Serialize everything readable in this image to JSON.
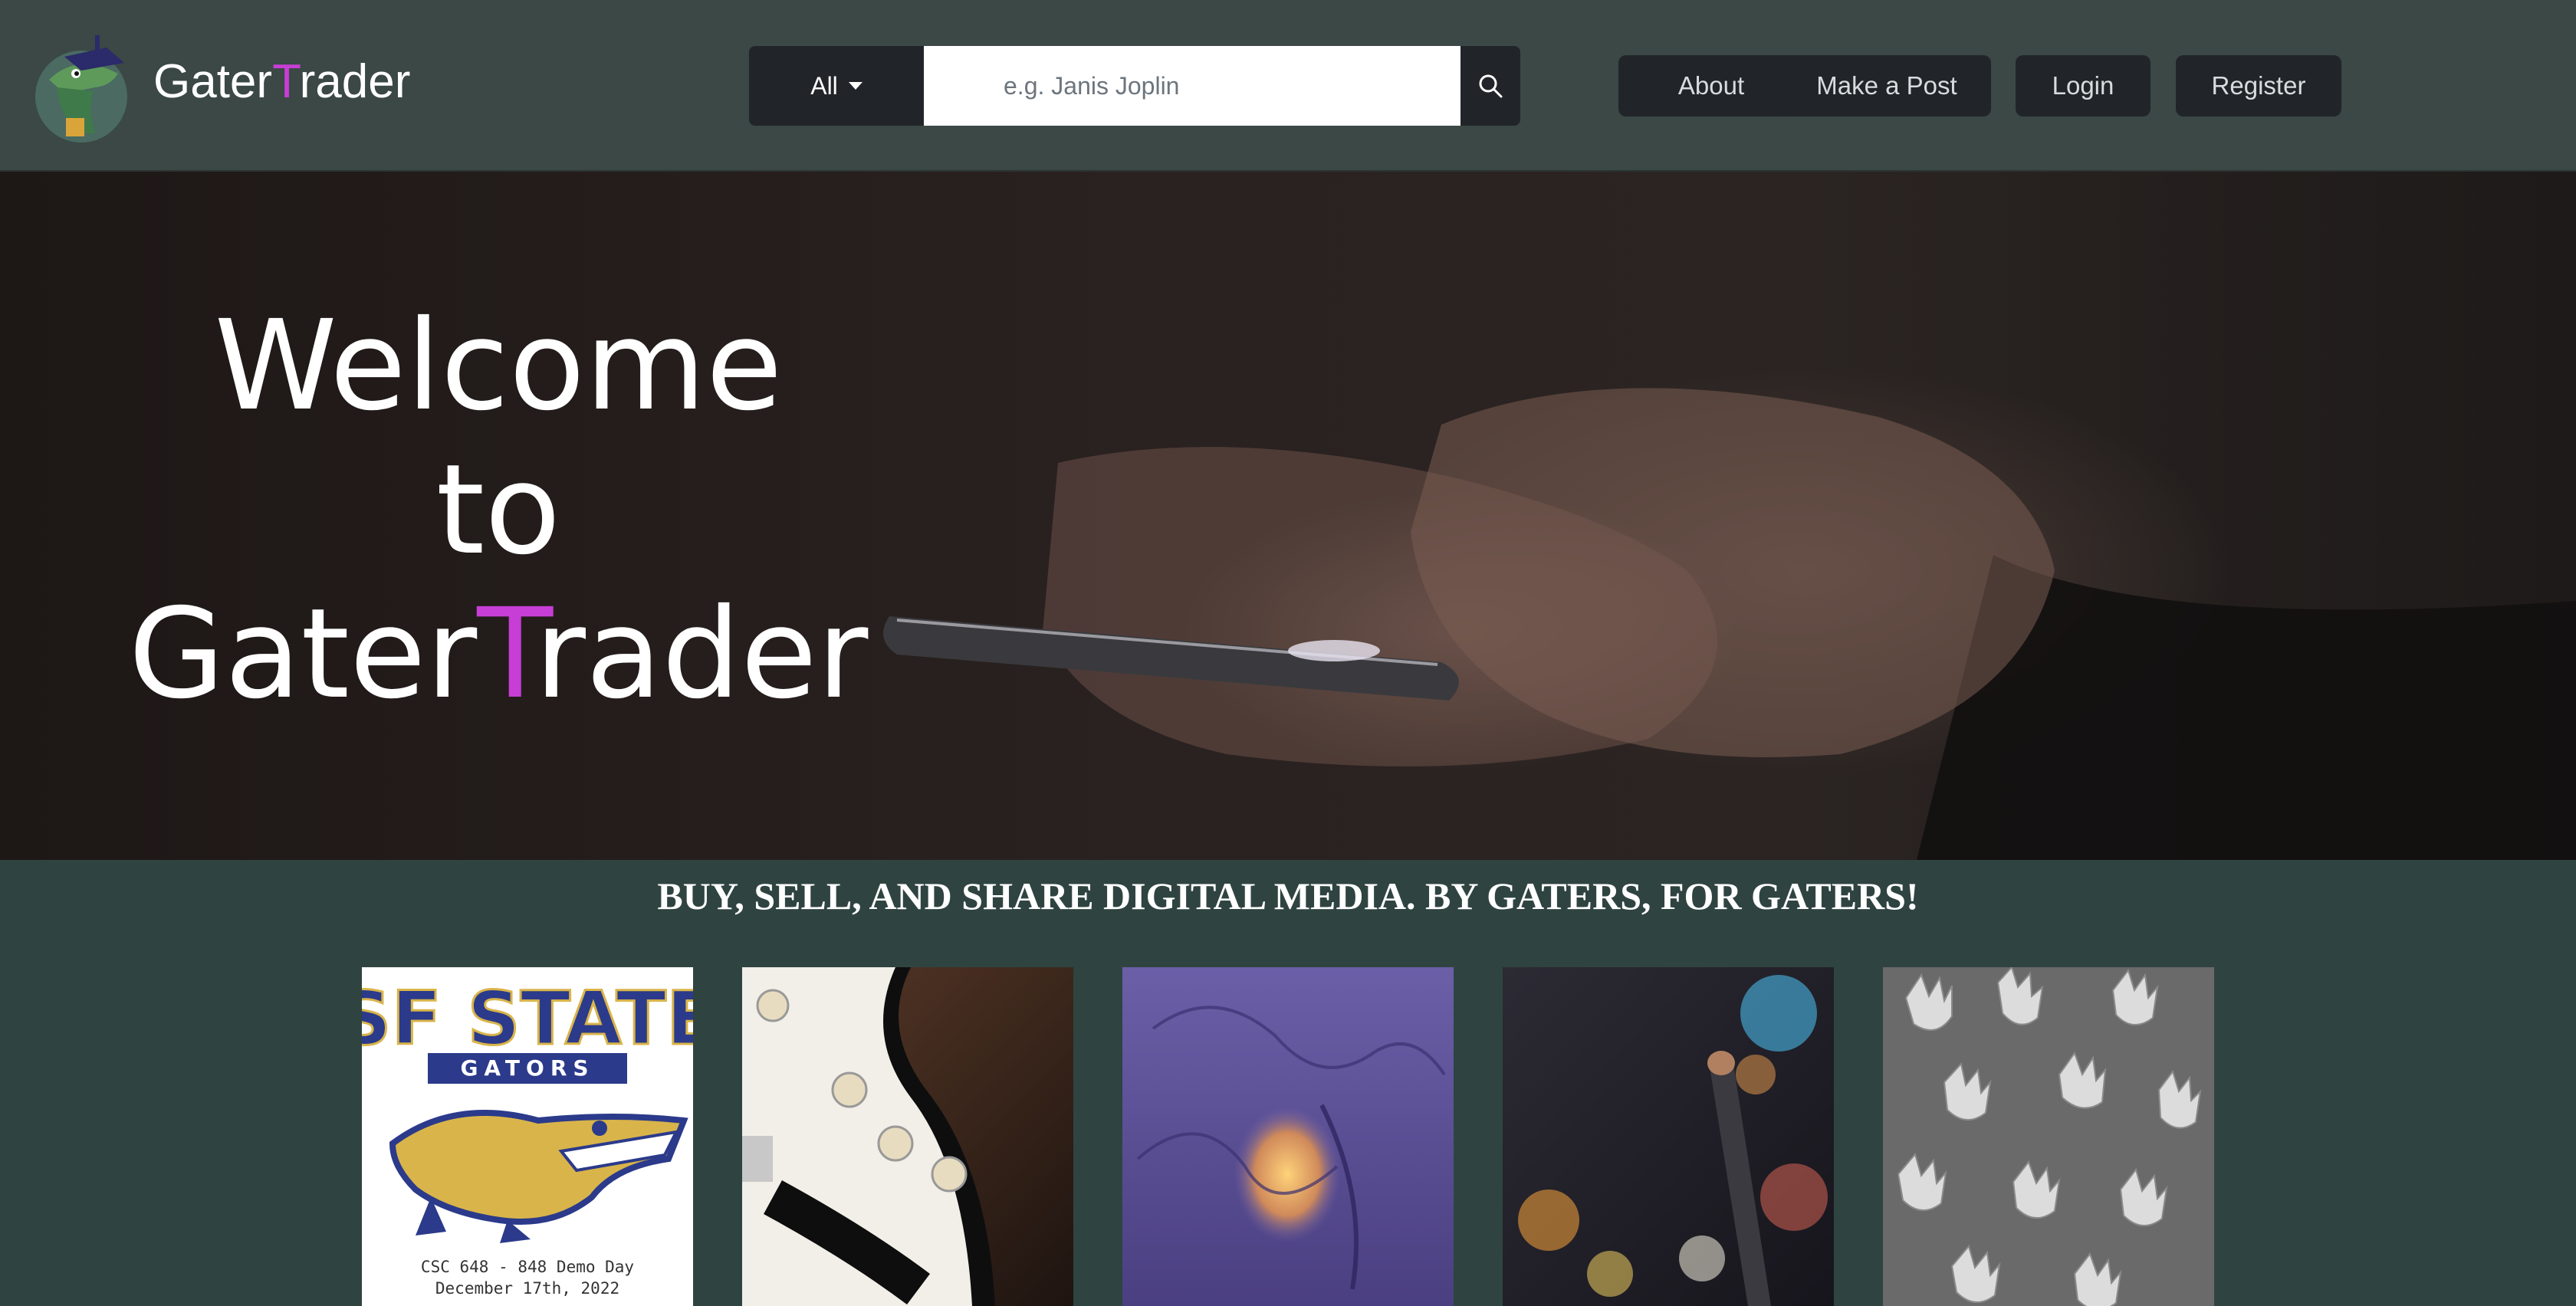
{
  "brand": {
    "name_part1": "Gater",
    "name_accent": "T",
    "name_part2": "rader"
  },
  "search": {
    "category_selected": "All",
    "placeholder": "e.g. Janis Joplin"
  },
  "nav": {
    "about": "About",
    "make_post": "Make a Post",
    "login": "Login",
    "register": "Register"
  },
  "hero": {
    "line1": "Welcome",
    "line2": "to",
    "line3_part1": "Gater",
    "line3_accent": "T",
    "line3_part2": "rader"
  },
  "tagline": "BUY, SELL, AND SHARE DIGITAL MEDIA. BY GATERS, FOR GATERS!",
  "cards": [
    {
      "name": "sf-state-demo-day",
      "logo_line1": "SF STATE",
      "logo_line2": "GATORS",
      "caption_line1": "CSC 648 - 848  Demo Day",
      "caption_line2": "December 17th, 2022"
    },
    {
      "name": "electric-guitar"
    },
    {
      "name": "purple-abstract-light"
    },
    {
      "name": "microphone-bokeh"
    },
    {
      "name": "hands-sculpture"
    }
  ],
  "colors": {
    "accent": "#c73ed6",
    "navbar": "#3b4845",
    "page_bg": "#2f4440",
    "button_bg": "#212529"
  }
}
